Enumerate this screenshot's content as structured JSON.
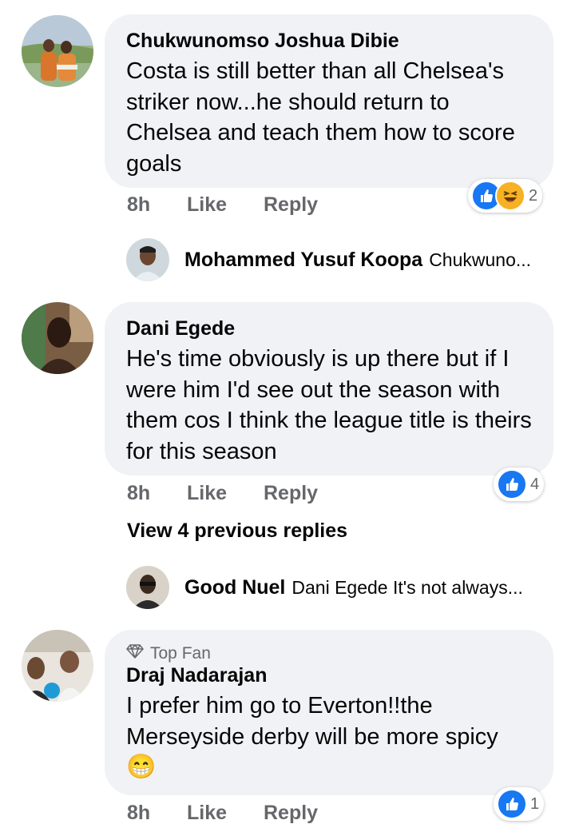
{
  "comments": [
    {
      "author": "Chukwunomso Joshua Dibie",
      "text": "Costa is still better than all Chelsea's striker now...he should return to Chelsea and teach them how to score goals",
      "time": "8h",
      "like": "Like",
      "reply": "Reply",
      "reaction_count": "2",
      "reactions": [
        "like-icon",
        "haha-icon"
      ]
    },
    {
      "author": "Dani Egede",
      "text": "He's time obviously is up there but if I were him I'd see out the season with them cos I think the league title is theirs for this season",
      "time": "8h",
      "like": "Like",
      "reply": "Reply",
      "reaction_count": "4",
      "reactions": [
        "like-icon"
      ]
    },
    {
      "badge": "Top Fan",
      "author": "Draj Nadarajan",
      "text": "I prefer him go to Everton!!the Merseyside derby will be more spicy",
      "emoji": "😁",
      "time": "8h",
      "like": "Like",
      "reply": "Reply",
      "reaction_count": "1",
      "reactions": [
        "like-icon"
      ]
    }
  ],
  "replies": [
    {
      "author": "Mohammed Yusuf Koopa",
      "preview": "Chukwuno..."
    },
    {
      "author": "Good Nuel",
      "preview": "Dani Egede It's not always..."
    }
  ],
  "view_more": "View 4 previous replies",
  "colors": {
    "like_blue": "#1877f2",
    "bubble": "#f0f2f5",
    "muted": "#65676b",
    "haha_yellow": "#f7b125"
  }
}
